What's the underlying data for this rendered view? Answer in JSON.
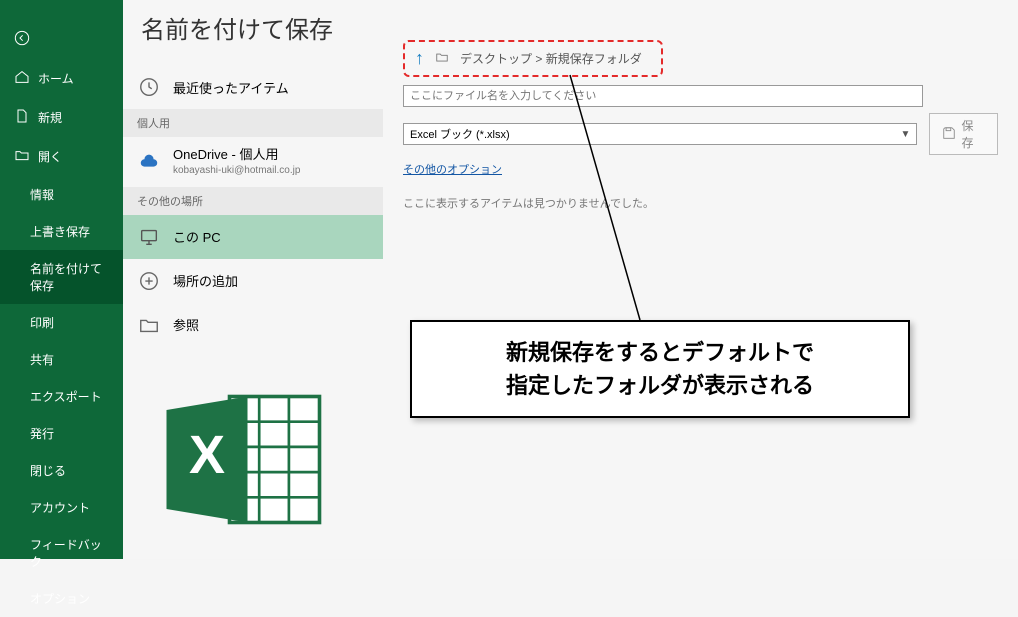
{
  "sidebar": {
    "back_home": "ホーム",
    "new": "新規",
    "open": "開く",
    "info": "情報",
    "save": "上書き保存",
    "saveas": "名前を付けて保存",
    "print": "印刷",
    "share": "共有",
    "export": "エクスポート",
    "publish": "発行",
    "close": "閉じる",
    "account": "アカウント",
    "feedback": "フィードバック",
    "options": "オプション"
  },
  "page_title": "名前を付けて保存",
  "locations": {
    "recent": "最近使ったアイテム",
    "personal_header": "個人用",
    "onedrive_title": "OneDrive - 個人用",
    "onedrive_sub": "kobayashi-uki@hotmail.co.jp",
    "other_header": "その他の場所",
    "thispc": "この PC",
    "addplace": "場所の追加",
    "browse": "参照"
  },
  "breadcrumb": {
    "path1": "デスクトップ",
    "sep": ">",
    "path2": "新規保存フォルダ"
  },
  "filename_placeholder": "ここにファイル名を入力してください",
  "filetype_value": "Excel ブック (*.xlsx)",
  "more_options": "その他のオプション",
  "save_button": "保存",
  "empty_msg": "ここに表示するアイテムは見つかりませんでした。",
  "callout_line1": "新規保存をするとデフォルトで",
  "callout_line2": "指定したフォルダが表示される"
}
